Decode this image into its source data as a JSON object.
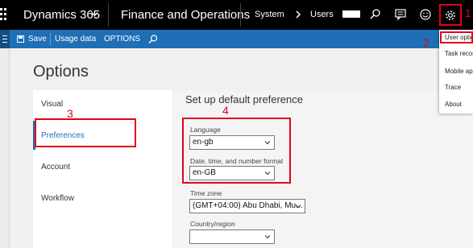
{
  "topbar": {
    "brand": "Dynamics 365",
    "module": "Finance and Operations",
    "breadcrumb": [
      "System",
      "Users"
    ],
    "icons": [
      "search-icon",
      "message-icon",
      "smiley-icon",
      "gear-icon"
    ]
  },
  "actionbar": {
    "save": "Save",
    "usage": "Usage data",
    "options": "OPTIONS"
  },
  "page": {
    "title": "Options",
    "nav": [
      "Visual",
      "Preferences",
      "Account",
      "Workflow"
    ],
    "active_nav": "Preferences",
    "section_title": "Set up default preference",
    "fields": {
      "language_label": "Language",
      "language_value": "en-gb",
      "format_label": "Date, time, and number format",
      "format_value": "en-GB",
      "timezone_label": "Time zone",
      "timezone_value": "(GMT+04:00) Abu Dhabi, Mu...",
      "country_label": "Country/region",
      "country_value": ""
    }
  },
  "menu": {
    "items": [
      "User optio",
      "Task recor",
      "Mobile ap",
      "Trace",
      "About"
    ]
  },
  "annotations": {
    "n1": "1",
    "n2": "2",
    "n3": "3",
    "n4": "4"
  },
  "colors": {
    "accent": "#1f6fb6",
    "annotation": "#e2001a"
  }
}
